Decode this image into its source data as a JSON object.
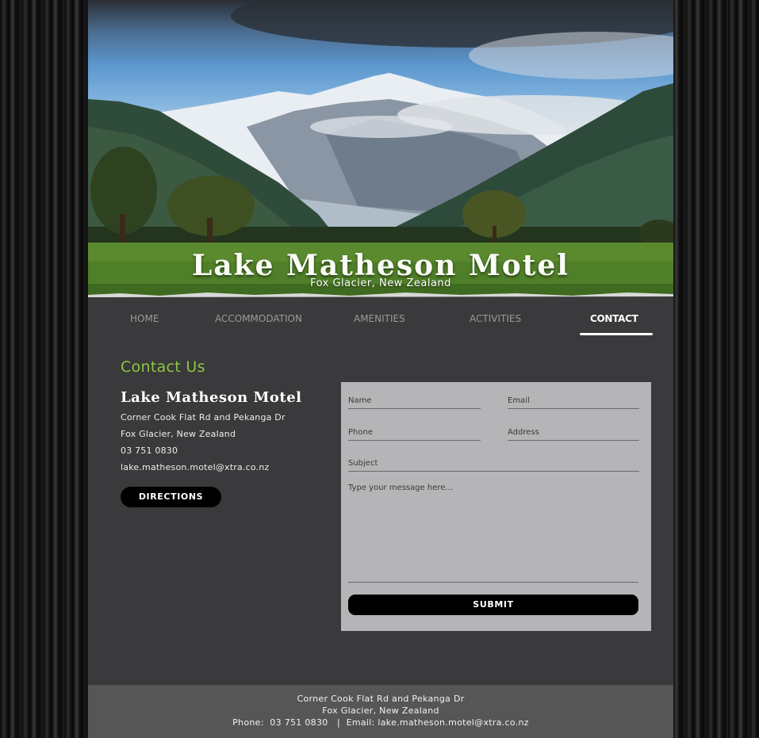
{
  "header": {
    "title": "Lake Matheson Motel",
    "subtitle": "Fox Glacier, New Zealand"
  },
  "nav": {
    "items": [
      {
        "label": "HOME"
      },
      {
        "label": "ACCOMMODATION"
      },
      {
        "label": "AMENITIES"
      },
      {
        "label": "ACTIVITIES"
      },
      {
        "label": "CONTACT"
      }
    ],
    "active": "CONTACT"
  },
  "contact": {
    "heading": "Contact Us",
    "business_name": "Lake Matheson Motel",
    "address_line1": "Corner Cook Flat Rd and Pekanga Dr",
    "address_line2": "Fox Glacier, New Zealand",
    "phone": "03 751 0830",
    "email": "lake.matheson.motel@xtra.co.nz",
    "directions_label": "DIRECTIONS"
  },
  "form": {
    "name_placeholder": "Name",
    "email_placeholder": "Email",
    "phone_placeholder": "Phone",
    "address_placeholder": "Address",
    "subject_placeholder": "Subject",
    "message_placeholder": "Type your message here...",
    "submit_label": "SUBMIT"
  },
  "footer": {
    "line1": "Corner Cook Flat Rd and Pekanga Dr",
    "line2": "Fox Glacier, New Zealand",
    "line3": "Phone:  03 751 0830   |  Email: lake.matheson.motel@xtra.co.nz"
  },
  "colors": {
    "accent_green": "#8ec641",
    "page_bg": "#3a393b",
    "form_bg": "#b5b5b7",
    "footer_bg": "#565656"
  }
}
